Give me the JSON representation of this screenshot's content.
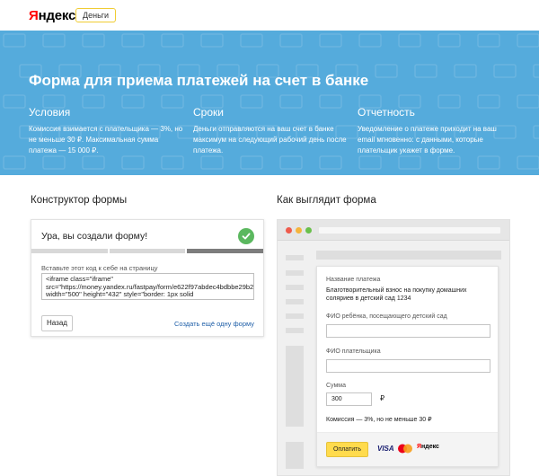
{
  "header": {
    "logo_first_letter": "Я",
    "logo_rest": "ндекс",
    "service_badge": "Деньги"
  },
  "hero": {
    "title": "Форма для приема платежей на счет в банке",
    "columns": [
      {
        "title": "Условия",
        "text": "Комиссия взимается с плательщика — 3%, но не меньше 30 ₽. Максимальная сумма платежа — 15 000 ₽."
      },
      {
        "title": "Сроки",
        "text": "Деньги отправляются на ваш счет в банке максимум на следующий рабочий день после платежа."
      },
      {
        "title": "Отчетность",
        "text": "Уведомление о платеже приходит на ваш email мгновенно: с данными, которые плательщик укажет в форме."
      }
    ]
  },
  "constructor": {
    "section_title": "Конструктор формы",
    "card_title": "Ура, вы создали форму!",
    "hint": "Вставьте этот код к себе на страницу",
    "code": "<iframe class=\"iframe\" src=\"https://money.yandex.ru/fastpay/form/e622f97abdec4bdbbe29b282c2a78dbe\" width=\"500\" height=\"432\" style=\"border: 1px solid",
    "back_label": "Назад",
    "create_another_label": "Создать ещё одну форму"
  },
  "preview": {
    "section_title": "Как выглядит форма",
    "dot_colors": [
      "#ef5b4c",
      "#f5b43c",
      "#69c04b"
    ],
    "form": {
      "purpose_label": "Название платежа",
      "purpose_value": "Благотворительный взнос на покупку домашних соляриев в детский сад 1234",
      "child_name_label": "ФИО ребёнка, посещающего детский сад",
      "payer_name_label": "ФИО плательщика",
      "amount_label": "Сумма",
      "amount_value": "300",
      "currency": "₽",
      "fee_text": "Комиссия — 3%, но не меньше 30 ₽",
      "pay_label": "Оплатить",
      "visa_label": "VISA",
      "ym_first_letter": "Я",
      "ym_rest": "ндекс"
    }
  }
}
